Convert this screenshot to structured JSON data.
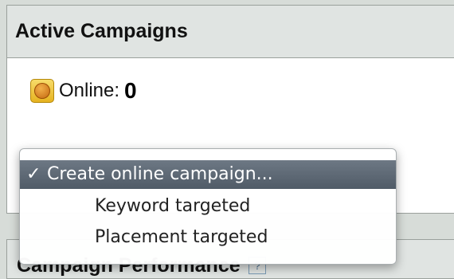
{
  "active_campaigns": {
    "title": "Active Campaigns",
    "online_label": "Online:",
    "online_count": "0",
    "online_icon": "globe-icon"
  },
  "dropdown": {
    "items": [
      {
        "check": "✓",
        "label": "Create online campaign...",
        "selected": true
      },
      {
        "label": "Keyword targeted",
        "selected": false
      },
      {
        "label": "Placement targeted",
        "selected": false
      }
    ]
  },
  "campaign_performance": {
    "title": "Campaign Performance",
    "help": "?"
  }
}
